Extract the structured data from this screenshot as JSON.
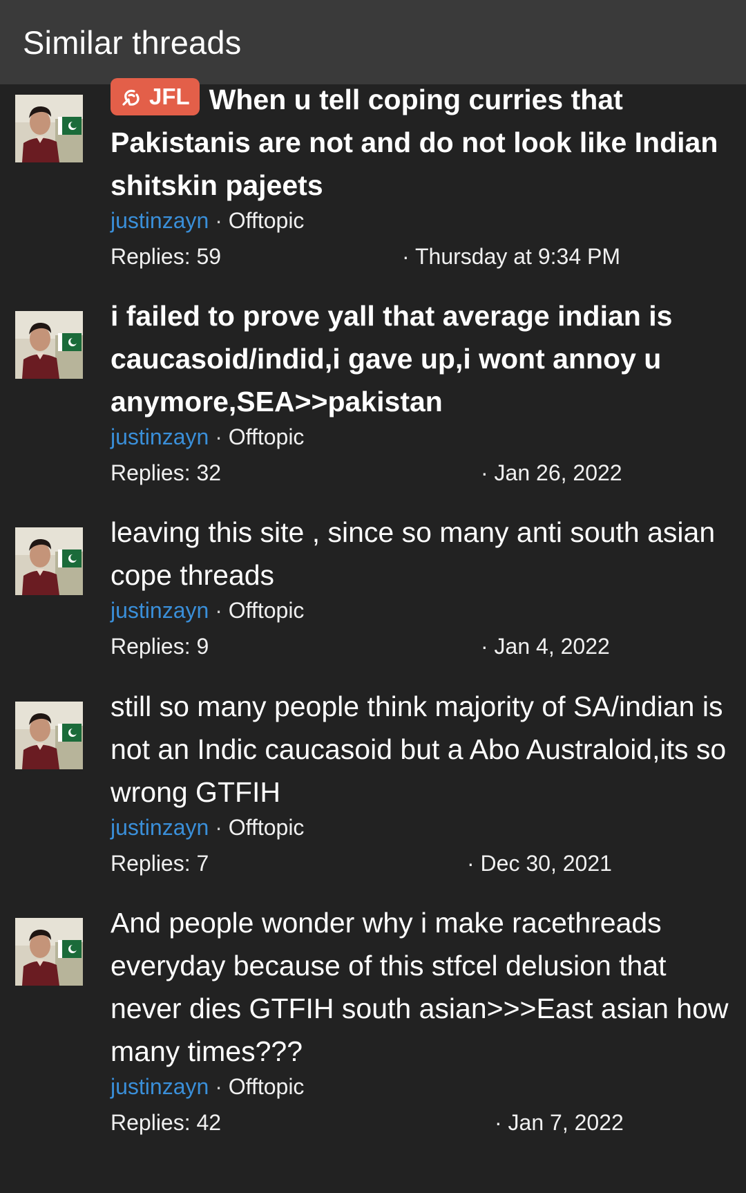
{
  "header": {
    "title": "Similar threads"
  },
  "threads": [
    {
      "prefix": "JFL",
      "title": "When u tell coping curries that Pakistanis are not and do not look like Indian shitskin pajeets",
      "author": "justinzayn",
      "forum": "Offtopic",
      "replies": "Replies: 59",
      "date": "· Thursday at 9:34 PM"
    },
    {
      "prefix": "",
      "title": "i failed to prove yall that average indian is caucasoid/indid,i gave up,i wont annoy u anymore,SEA>>pakistan",
      "author": "justinzayn",
      "forum": "Offtopic",
      "replies": "Replies: 32",
      "date": "· Jan 26, 2022"
    },
    {
      "prefix": "",
      "title": "leaving this site , since so many anti south asian cope threads",
      "author": "justinzayn",
      "forum": "Offtopic",
      "replies": "Replies: 9",
      "date": "· Jan 4, 2022"
    },
    {
      "prefix": "",
      "title": "still so many people think majority of SA/indian is not an Indic caucasoid but a Abo Australoid,its so wrong GTFIH",
      "author": "justinzayn",
      "forum": "Offtopic",
      "replies": "Replies: 7",
      "date": "· Dec 30, 2021"
    },
    {
      "prefix": "",
      "title": "And people wonder why i make racethreads everyday because of this stfcel delusion that never dies GTFIH south asian>>>East asian how many times???",
      "author": "justinzayn",
      "forum": "Offtopic",
      "replies": "Replies: 42",
      "date": "· Jan 7, 2022"
    }
  ],
  "meta_separator": " · "
}
